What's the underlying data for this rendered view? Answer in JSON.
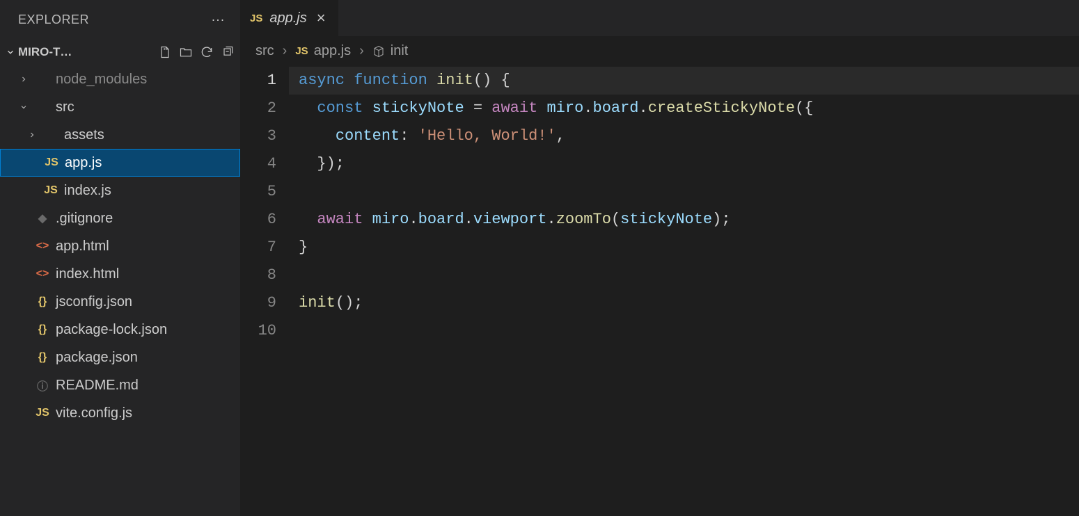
{
  "sidebar": {
    "title": "EXPLORER",
    "project_name": "MIRO-T…",
    "tree": [
      {
        "label": "node_modules",
        "type": "folder",
        "collapsed": true,
        "depth": 0
      },
      {
        "label": "src",
        "type": "folder",
        "collapsed": false,
        "depth": 0
      },
      {
        "label": "assets",
        "type": "folder",
        "collapsed": true,
        "depth": 1
      },
      {
        "label": "app.js",
        "type": "js",
        "depth": 1,
        "selected": true
      },
      {
        "label": "index.js",
        "type": "js",
        "depth": 1
      },
      {
        "label": ".gitignore",
        "type": "git",
        "depth": 0
      },
      {
        "label": "app.html",
        "type": "html",
        "depth": 0
      },
      {
        "label": "index.html",
        "type": "html",
        "depth": 0
      },
      {
        "label": "jsconfig.json",
        "type": "json",
        "depth": 0
      },
      {
        "label": "package-lock.json",
        "type": "json",
        "depth": 0
      },
      {
        "label": "package.json",
        "type": "json",
        "depth": 0
      },
      {
        "label": "README.md",
        "type": "info",
        "depth": 0
      },
      {
        "label": "vite.config.js",
        "type": "js",
        "depth": 0
      }
    ]
  },
  "tab": {
    "icon": "JS",
    "label": "app.js"
  },
  "breadcrumbs": {
    "part1": "src",
    "part2": "app.js",
    "part3": "init",
    "icon2": "JS"
  },
  "code": {
    "current_line": 1,
    "lines": [
      [
        {
          "t": "async",
          "c": "k-blue"
        },
        {
          "t": " "
        },
        {
          "t": "function",
          "c": "k-blue"
        },
        {
          "t": " "
        },
        {
          "t": "init",
          "c": "k-fn"
        },
        {
          "t": "() {",
          "c": "k-pun"
        }
      ],
      [
        {
          "t": "  "
        },
        {
          "t": "const",
          "c": "k-blue"
        },
        {
          "t": " "
        },
        {
          "t": "stickyNote",
          "c": "k-var"
        },
        {
          "t": " = "
        },
        {
          "t": "await",
          "c": "k-purple"
        },
        {
          "t": " "
        },
        {
          "t": "miro",
          "c": "k-var"
        },
        {
          "t": "."
        },
        {
          "t": "board",
          "c": "k-var"
        },
        {
          "t": "."
        },
        {
          "t": "createStickyNote",
          "c": "k-fn"
        },
        {
          "t": "({",
          "c": "k-pun"
        }
      ],
      [
        {
          "t": "    "
        },
        {
          "t": "content",
          "c": "k-var"
        },
        {
          "t": ": "
        },
        {
          "t": "'Hello, World!'",
          "c": "k-str"
        },
        {
          "t": ",",
          "c": "k-pun"
        }
      ],
      [
        {
          "t": "  });",
          "c": "k-pun"
        }
      ],
      [
        {
          "t": ""
        }
      ],
      [
        {
          "t": "  "
        },
        {
          "t": "await",
          "c": "k-purple"
        },
        {
          "t": " "
        },
        {
          "t": "miro",
          "c": "k-var"
        },
        {
          "t": "."
        },
        {
          "t": "board",
          "c": "k-var"
        },
        {
          "t": "."
        },
        {
          "t": "viewport",
          "c": "k-var"
        },
        {
          "t": "."
        },
        {
          "t": "zoomTo",
          "c": "k-fn"
        },
        {
          "t": "(",
          "c": "k-pun"
        },
        {
          "t": "stickyNote",
          "c": "k-var"
        },
        {
          "t": ");",
          "c": "k-pun"
        }
      ],
      [
        {
          "t": "}",
          "c": "k-pun"
        }
      ],
      [
        {
          "t": ""
        }
      ],
      [
        {
          "t": "init",
          "c": "k-fn"
        },
        {
          "t": "();",
          "c": "k-pun"
        }
      ],
      [
        {
          "t": ""
        }
      ]
    ]
  }
}
